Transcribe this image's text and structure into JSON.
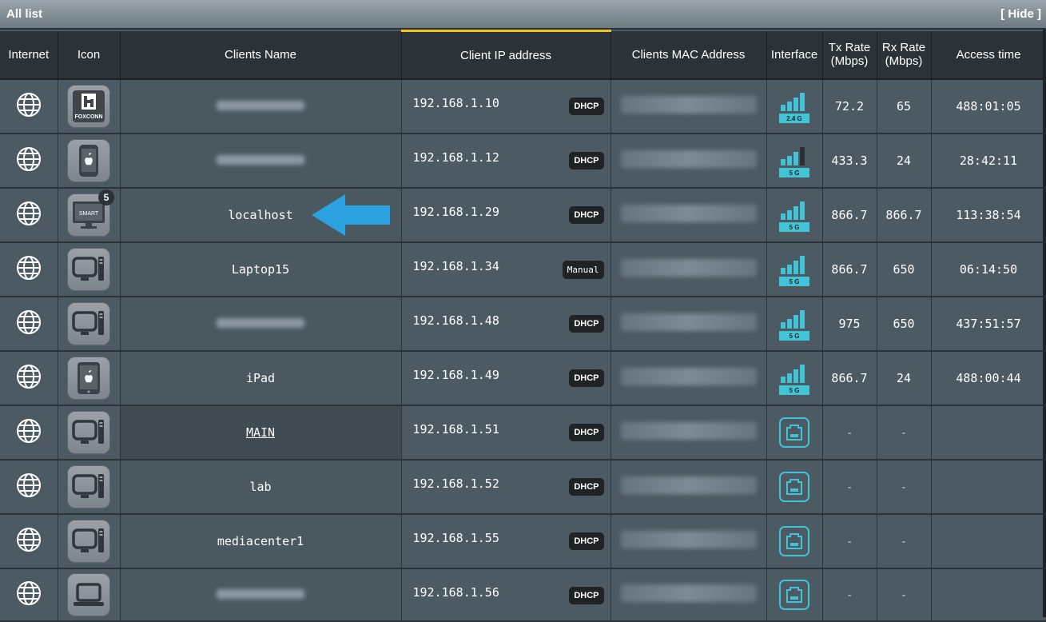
{
  "panel": {
    "title": "All list",
    "hide_label": "[ Hide ]"
  },
  "columns": [
    "Internet",
    "Icon",
    "Clients Name",
    "Client IP address",
    "Clients MAC Address",
    "Interface",
    "Tx Rate\n(Mbps)",
    "Rx Rate\n(Mbps)",
    "Access time"
  ],
  "colors": {
    "accent_sort": "#f0c419",
    "interface_cyan": "#42c3d6",
    "arrow_blue": "#2ba1e0",
    "tag_bg": "#1e2326"
  },
  "rows": [
    {
      "icon": "foxconn-icon",
      "icon_text": "FOXCONN",
      "name": "",
      "name_blurred": true,
      "ip": "192.168.1.10",
      "ip_type": "DHCP",
      "interface": "wifi",
      "band": "2.4 G",
      "signal": 4,
      "tx": "72.2",
      "rx": "65",
      "time": "488:01:05"
    },
    {
      "icon": "apple-phone-icon",
      "name": "",
      "name_blurred": true,
      "ip": "192.168.1.12",
      "ip_type": "DHCP",
      "interface": "wifi",
      "band": "5 G",
      "signal": 3,
      "tx": "433.3",
      "rx": "24",
      "time": "28:42:11"
    },
    {
      "icon": "smart-tv-icon",
      "icon_text": "SMART",
      "badge": "5",
      "name": "localhost",
      "ip": "192.168.1.29",
      "ip_type": "DHCP",
      "interface": "wifi",
      "band": "5 G",
      "signal": 4,
      "tx": "866.7",
      "rx": "866.7",
      "time": "113:38:54"
    },
    {
      "icon": "desktop-computer-icon",
      "name": "Laptop15",
      "ip": "192.168.1.34",
      "ip_type": "Manual",
      "interface": "wifi",
      "band": "5 G",
      "signal": 4,
      "tx": "866.7",
      "rx": "650",
      "time": "06:14:50"
    },
    {
      "icon": "desktop-computer-icon",
      "name": "",
      "name_blurred": true,
      "ip": "192.168.1.48",
      "ip_type": "DHCP",
      "interface": "wifi",
      "band": "5 G",
      "signal": 4,
      "tx": "975",
      "rx": "650",
      "time": "437:51:57"
    },
    {
      "icon": "apple-tablet-icon",
      "name": "iPad",
      "ip": "192.168.1.49",
      "ip_type": "DHCP",
      "interface": "wifi",
      "band": "5 G",
      "signal": 4,
      "tx": "866.7",
      "rx": "24",
      "time": "488:00:44"
    },
    {
      "icon": "desktop-computer-icon",
      "name": "MAIN",
      "name_link": true,
      "ip": "192.168.1.51",
      "ip_type": "DHCP",
      "interface": "lan",
      "tx": "-",
      "rx": "-",
      "time": ""
    },
    {
      "icon": "desktop-computer-icon",
      "name": "lab",
      "ip": "192.168.1.52",
      "ip_type": "DHCP",
      "interface": "lan",
      "tx": "-",
      "rx": "-",
      "time": ""
    },
    {
      "icon": "desktop-computer-icon",
      "name": "mediacenter1",
      "ip": "192.168.1.55",
      "ip_type": "DHCP",
      "interface": "lan",
      "tx": "-",
      "rx": "-",
      "time": ""
    },
    {
      "icon": "laptop-icon",
      "name": "",
      "name_blurred": true,
      "ip": "192.168.1.56",
      "ip_type": "DHCP",
      "interface": "lan",
      "tx": "-",
      "rx": "-",
      "time": ""
    }
  ]
}
